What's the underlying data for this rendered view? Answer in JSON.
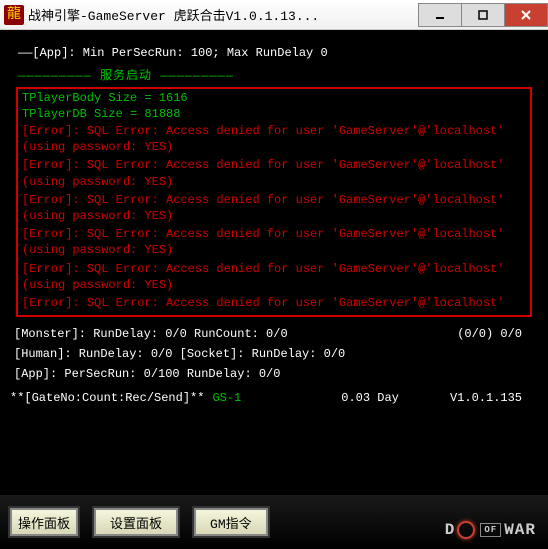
{
  "titlebar": {
    "icon_char": "龍",
    "title": "战神引擎-GameServer 虎跃合击V1.0.1.13..."
  },
  "top_app_line": "——[App]: Min PerSecRun: 100; Max RunDelay 0",
  "service_header": "服务启动",
  "info_lines": {
    "player_body": "TPlayerBody Size = 1616",
    "player_db": "TPlayerDB Size = 81888"
  },
  "errors": [
    "[Error]: SQL Error: Access denied for user 'GameServer'@'localhost' (using password: YES)",
    "[Error]: SQL Error: Access denied for user 'GameServer'@'localhost' (using password: YES)",
    "[Error]: SQL Error: Access denied for user 'GameServer'@'localhost' (using password: YES)",
    "[Error]: SQL Error: Access denied for user 'GameServer'@'localhost' (using password: YES)",
    "[Error]: SQL Error: Access denied for user 'GameServer'@'localhost' (using password: YES)",
    "[Error]: SQL Error: Access denied for user 'GameServer'@'localhost'"
  ],
  "stats": {
    "monster": "[Monster]: RunDelay: 0/0  RunCount: 0/0",
    "monster_right": "(0/0) 0/0",
    "human": "[Human]: RunDelay: 0/0  [Socket]: RunDelay: 0/0",
    "app": "[App]: PerSecRun: 0/100  RunDelay: 0/0"
  },
  "gate": {
    "label": "**[GateNo:Count:Rec/Send]**",
    "id": "GS-1",
    "day": "0.03 Day",
    "version": "V1.0.1.135"
  },
  "buttons": {
    "ops_panel": "操作面板",
    "settings_panel": "设置面板",
    "gm_cmd": "GM指令"
  },
  "logo": {
    "d": "D",
    "of": "OF",
    "war": "WAR"
  }
}
